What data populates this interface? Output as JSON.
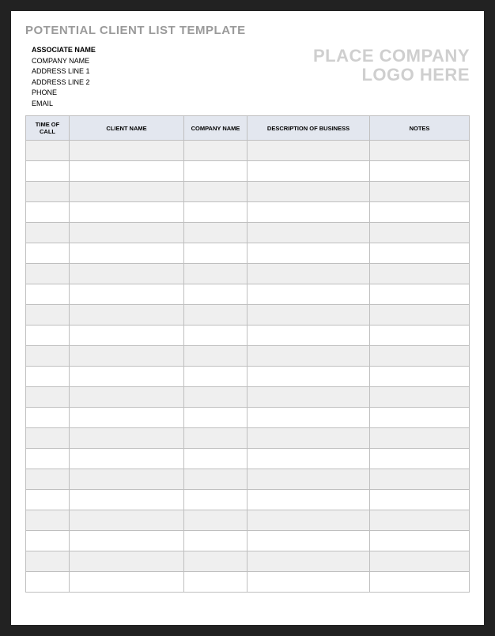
{
  "title": "POTENTIAL CLIENT LIST TEMPLATE",
  "associate": {
    "name_label": "ASSOCIATE NAME",
    "company_label": "COMPANY NAME",
    "address1_label": "ADDRESS LINE 1",
    "address2_label": "ADDRESS LINE 2",
    "phone_label": "PHONE",
    "email_label": "EMAIL"
  },
  "logo": {
    "line1": "PLACE COMPANY",
    "line2": "LOGO HERE"
  },
  "table": {
    "headers": {
      "time_of_call": "TIME OF CALL",
      "client_name": "CLIENT NAME",
      "company_name": "COMPANY NAME",
      "description": "DESCRIPTION OF BUSINESS",
      "notes": "NOTES"
    },
    "rows": [
      {
        "time": "",
        "client": "",
        "company": "",
        "desc": "",
        "notes": ""
      },
      {
        "time": "",
        "client": "",
        "company": "",
        "desc": "",
        "notes": ""
      },
      {
        "time": "",
        "client": "",
        "company": "",
        "desc": "",
        "notes": ""
      },
      {
        "time": "",
        "client": "",
        "company": "",
        "desc": "",
        "notes": ""
      },
      {
        "time": "",
        "client": "",
        "company": "",
        "desc": "",
        "notes": ""
      },
      {
        "time": "",
        "client": "",
        "company": "",
        "desc": "",
        "notes": ""
      },
      {
        "time": "",
        "client": "",
        "company": "",
        "desc": "",
        "notes": ""
      },
      {
        "time": "",
        "client": "",
        "company": "",
        "desc": "",
        "notes": ""
      },
      {
        "time": "",
        "client": "",
        "company": "",
        "desc": "",
        "notes": ""
      },
      {
        "time": "",
        "client": "",
        "company": "",
        "desc": "",
        "notes": ""
      },
      {
        "time": "",
        "client": "",
        "company": "",
        "desc": "",
        "notes": ""
      },
      {
        "time": "",
        "client": "",
        "company": "",
        "desc": "",
        "notes": ""
      },
      {
        "time": "",
        "client": "",
        "company": "",
        "desc": "",
        "notes": ""
      },
      {
        "time": "",
        "client": "",
        "company": "",
        "desc": "",
        "notes": ""
      },
      {
        "time": "",
        "client": "",
        "company": "",
        "desc": "",
        "notes": ""
      },
      {
        "time": "",
        "client": "",
        "company": "",
        "desc": "",
        "notes": ""
      },
      {
        "time": "",
        "client": "",
        "company": "",
        "desc": "",
        "notes": ""
      },
      {
        "time": "",
        "client": "",
        "company": "",
        "desc": "",
        "notes": ""
      },
      {
        "time": "",
        "client": "",
        "company": "",
        "desc": "",
        "notes": ""
      },
      {
        "time": "",
        "client": "",
        "company": "",
        "desc": "",
        "notes": ""
      },
      {
        "time": "",
        "client": "",
        "company": "",
        "desc": "",
        "notes": ""
      },
      {
        "time": "",
        "client": "",
        "company": "",
        "desc": "",
        "notes": ""
      }
    ]
  }
}
